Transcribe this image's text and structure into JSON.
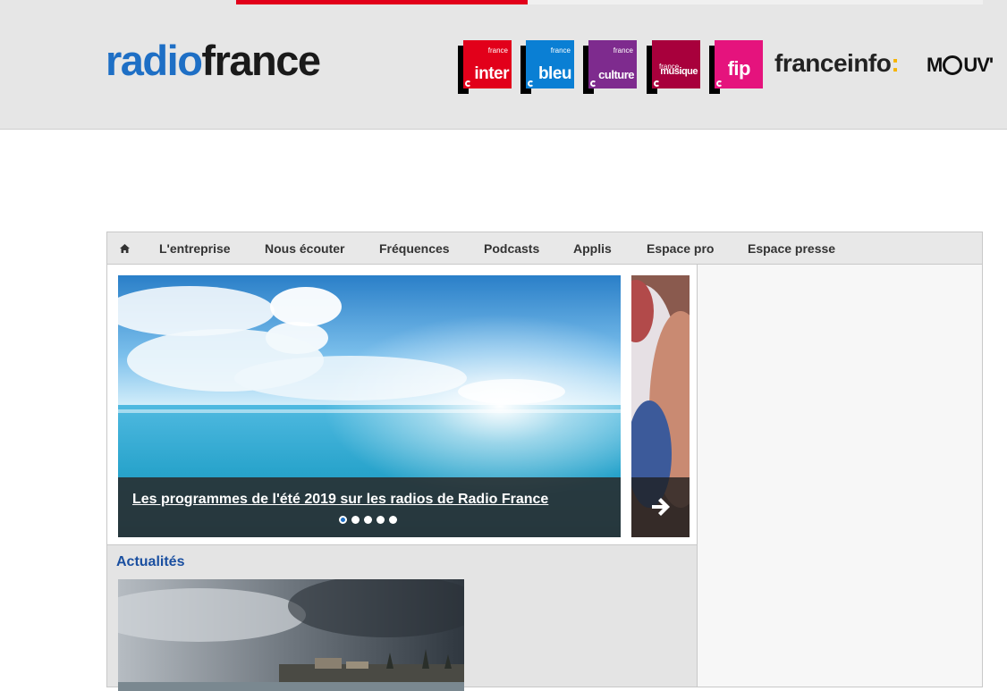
{
  "progress": {
    "fraction": 0.39,
    "fill_color": "#e2001a"
  },
  "header": {
    "logo": {
      "part1": "radio",
      "part2": "france",
      "colors": {
        "radio": "#1e6fc5",
        "france": "#1a1a1a"
      }
    },
    "stations": [
      {
        "small": "france",
        "big": "inter",
        "color": "#e2001a"
      },
      {
        "small": "france",
        "big": "bleu",
        "color": "#0a7fd4"
      },
      {
        "small": "france",
        "big": "culture",
        "color": "#7e2b8e"
      },
      {
        "small": "france",
        "big": "musique",
        "color": "#a8003c"
      },
      {
        "small": "",
        "big": "fip",
        "color": "#e5137d"
      }
    ],
    "franceinfo": {
      "text": "franceinfo",
      "colon": ":"
    },
    "mouv": {
      "m": "M",
      "rest": "UV'"
    }
  },
  "nav": {
    "home_icon": "home-icon",
    "items": [
      "L'entreprise",
      "Nous écouter",
      "Fréquences",
      "Podcasts",
      "Applis",
      "Espace pro",
      "Espace presse"
    ]
  },
  "slider": {
    "caption": "Les programmes de l'été 2019 sur les radios de Radio France",
    "dots_total": 5,
    "active_dot": 0,
    "next_icon": "arrow-right-icon"
  },
  "news": {
    "section_title": "Actualités"
  }
}
